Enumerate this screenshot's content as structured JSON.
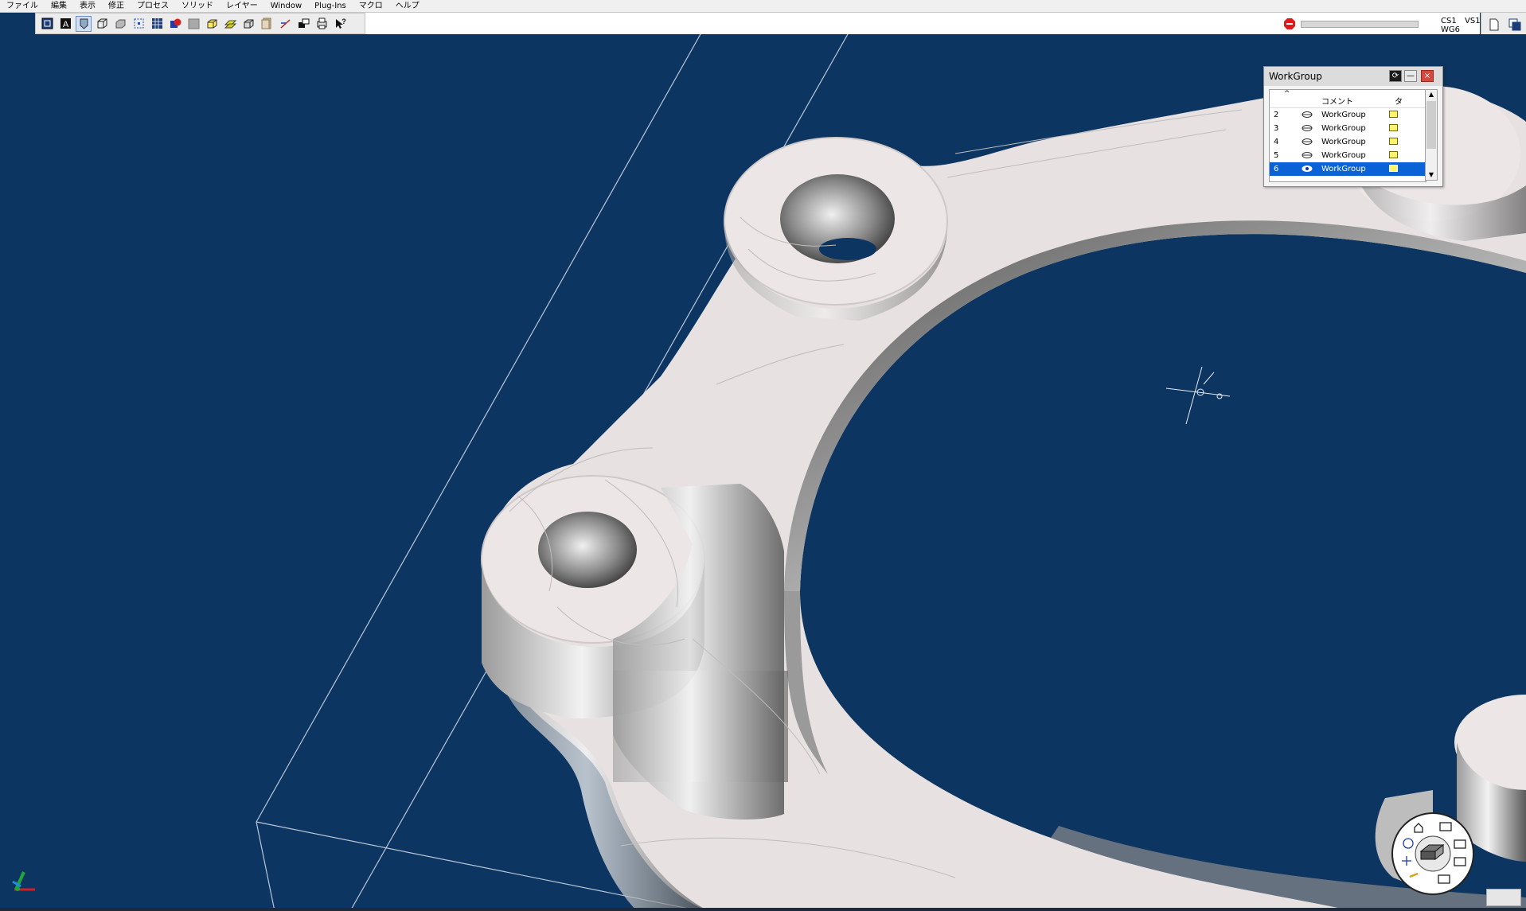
{
  "menu": {
    "items": [
      "ファイル",
      "編集",
      "表示",
      "修正",
      "プロセス",
      "ソリッド",
      "レイヤー",
      "Window",
      "Plug-Ins",
      "マクロ",
      "ヘルプ"
    ]
  },
  "toolbar": {
    "icons": [
      "wireframe-icon",
      "text-a-icon",
      "shaded-icon",
      "box-view-icon",
      "solid-view-icon",
      "select-box-icon",
      "grid-icon",
      "color-icon",
      "gray-fill-icon",
      "iso-view-icon",
      "yellow-plane-icon",
      "stack-view-icon",
      "layer-icon",
      "snap-icon",
      "move-icon",
      "print-icon",
      "help-icon"
    ]
  },
  "status": {
    "cs": "CS1",
    "vs": "VS1",
    "wg": "WG6",
    "progress": 0,
    "stop_color": "#e01a1a"
  },
  "workgroup_panel": {
    "title": "WorkGroup",
    "header": {
      "comment": "コメント",
      "col": "タ"
    },
    "rows": [
      {
        "num": "2",
        "name": "WorkGroup",
        "selected": false
      },
      {
        "num": "3",
        "name": "WorkGroup",
        "selected": false
      },
      {
        "num": "4",
        "name": "WorkGroup",
        "selected": false
      },
      {
        "num": "5",
        "name": "WorkGroup",
        "selected": false
      },
      {
        "num": "6",
        "name": "WorkGroup",
        "selected": true
      }
    ]
  },
  "colors": {
    "viewport_bg": "#0d3561",
    "part_face": "#ebe5e5",
    "selection": "#0a62d6"
  }
}
